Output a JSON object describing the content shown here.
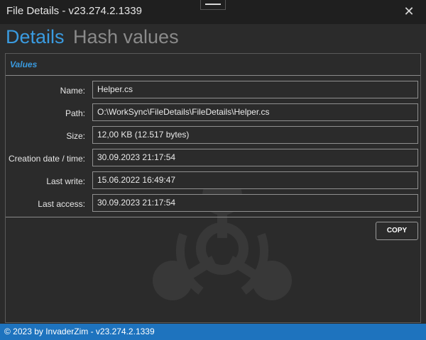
{
  "window": {
    "title": "File Details - v23.274.2.1339",
    "close_glyph": "✕"
  },
  "tabs": [
    {
      "label": "Details",
      "active": true
    },
    {
      "label": "Hash values",
      "active": false
    }
  ],
  "section": {
    "title": "Values"
  },
  "fields": [
    {
      "label": "Name:",
      "value": "Helper.cs"
    },
    {
      "label": "Path:",
      "value": "O:\\WorkSync\\FileDetails\\FileDetails\\Helper.cs"
    },
    {
      "label": "Size:",
      "value": "12,00 KB (12.517 bytes)"
    },
    {
      "label": "Creation date / time:",
      "value": "30.09.2023 21:17:54"
    },
    {
      "label": "Last write:",
      "value": "15.06.2022 16:49:47"
    },
    {
      "label": "Last access:",
      "value": "30.09.2023 21:17:54"
    }
  ],
  "actions": {
    "copy_label": "COPY"
  },
  "status": {
    "text": "© 2023 by InvaderZim - v23.274.2.1339"
  },
  "colors": {
    "accent": "#3a9be0",
    "statusbar": "#1e73be",
    "background": "#2b2b2b"
  }
}
